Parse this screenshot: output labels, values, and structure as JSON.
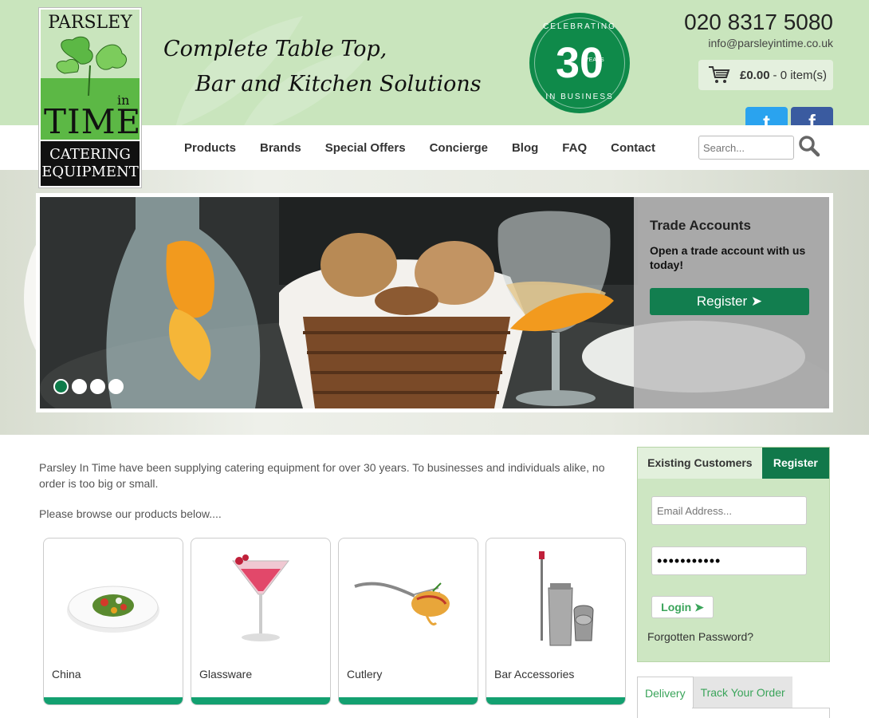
{
  "header": {
    "tagline_line1": "Complete Table Top,",
    "tagline_line2": "Bar and Kitchen Solutions",
    "phone": "020 8317 5080",
    "email": "info@parsleyintime.co.uk",
    "badge": {
      "number": "30",
      "years": "YEARS",
      "top_text": "CELEBRATING",
      "bottom_text": "IN BUSINESS"
    }
  },
  "logo": {
    "parsley": "PARSLEY",
    "in": "in",
    "time": "TIME",
    "catering": "CATERING",
    "equipment": "EQUIPMENT"
  },
  "cart": {
    "amount": "£0.00",
    "items": "- 0 item(s)"
  },
  "social": {
    "twitter_icon": "twitter-icon",
    "facebook_icon": "facebook-icon"
  },
  "nav": {
    "items": [
      "Products",
      "Brands",
      "Special Offers",
      "Concierge",
      "Blog",
      "FAQ",
      "Contact"
    ]
  },
  "search": {
    "placeholder": "Search...",
    "icon": "search-icon"
  },
  "hero": {
    "trade_title": "Trade Accounts",
    "trade_text": "Open a trade account with us today!",
    "register_label": "Register ➤",
    "active_slide": 1,
    "slide_count": 4
  },
  "intro": {
    "paragraph": "Parsley In Time have been supplying catering equipment for over 30 years. To businesses and individuals alike, no order is too big or small.",
    "browse": "Please browse our products below...."
  },
  "categories": [
    "China",
    "Glassware",
    "Cutlery",
    "Bar Accessories"
  ],
  "login": {
    "tab_existing": "Existing Customers",
    "tab_register": "Register",
    "email_placeholder": "Email Address...",
    "password_value": "•••••••••••",
    "login_label": "Login ➤",
    "forgot": "Forgotten Password?"
  },
  "delivery_tabs": {
    "delivery": "Delivery",
    "track": "Track Your Order"
  },
  "colors": {
    "brand_green": "#127e4f",
    "header_bg": "#c9e5bd",
    "card_bar": "#13a070",
    "link_green": "#3aa45a"
  }
}
